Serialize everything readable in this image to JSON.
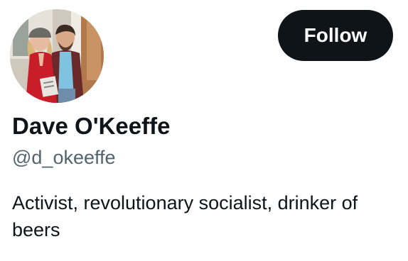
{
  "profile": {
    "display_name": "Dave O'Keeffe",
    "handle": "@d_okeeffe",
    "bio": "Activist, revolutionary socialist, drinker of beers",
    "avatar_icon": "profile-photo"
  },
  "actions": {
    "follow_label": "Follow"
  },
  "colors": {
    "button_bg": "#0f1419",
    "button_text": "#ffffff",
    "primary_text": "#0f1419",
    "secondary_text": "#536471"
  }
}
